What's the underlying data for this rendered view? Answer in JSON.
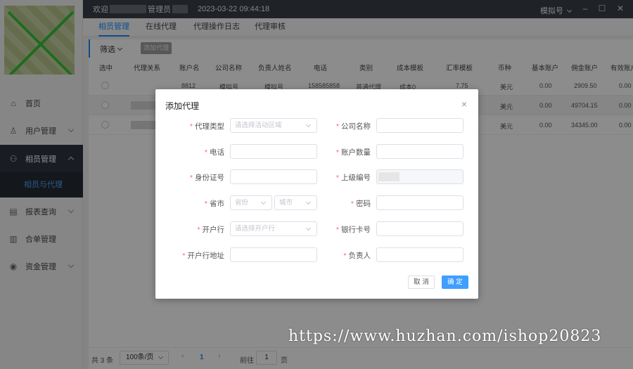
{
  "topbar": {
    "welcome_prefix": "欢迎",
    "welcome_suffix": "管理员",
    "datetime": "2023-03-22 09:44:18",
    "user": "模拟号"
  },
  "tabs": [
    "相员管理",
    "在线代理",
    "代理操作日志",
    "代理审核"
  ],
  "sidebar": {
    "items": [
      {
        "label": "首页",
        "icon": "home-icon"
      },
      {
        "label": "用户管理",
        "icon": "user-icon"
      },
      {
        "label": "相员管理",
        "icon": "users-icon"
      },
      {
        "label": "报表查询",
        "icon": "report-icon"
      },
      {
        "label": "合单管理",
        "icon": "order-icon"
      },
      {
        "label": "资金管理",
        "icon": "money-icon"
      }
    ],
    "sub_item": "相员与代理"
  },
  "toolbar": {
    "filter_label": "筛选",
    "add_button": "添加代理"
  },
  "table": {
    "columns": [
      "选中",
      "代理关系",
      "账户名",
      "公司名称",
      "负责人姓名",
      "电话",
      "类别",
      "成本模板",
      "汇率模板",
      "币种",
      "基本账户",
      "佣金账户",
      "有效账户"
    ],
    "rows": [
      {
        "account": "8812",
        "company": "模拟号",
        "contact": "模拟号",
        "phone": "158585858",
        "category": "普通代理",
        "cost_template": "成本0",
        "rate_template": "7.75",
        "currency": "美元",
        "basic": "0.00",
        "commission": "2909.50",
        "valid": "0.00"
      },
      {
        "account": "",
        "company": "",
        "contact": "",
        "phone": "",
        "category": "",
        "cost_template": "",
        "rate_template": "",
        "currency": "美元",
        "basic": "0.00",
        "commission": "49704.15",
        "valid": "0.00"
      },
      {
        "account": "",
        "company": "",
        "contact": "",
        "phone": "",
        "category": "",
        "cost_template": "",
        "rate_template": "",
        "currency": "美元",
        "basic": "0.00",
        "commission": "34345.00",
        "valid": "0.00"
      }
    ]
  },
  "pagination": {
    "total": "共 3 条",
    "page_size": "100条/页",
    "prev": "‹",
    "current": "1",
    "next": "›",
    "goto_label": "前往",
    "goto_value": "1",
    "page_suffix": "页"
  },
  "modal": {
    "title": "添加代理",
    "close": "×",
    "fields": {
      "agent_type": {
        "label": "代理类型",
        "placeholder": "请选择活动区域",
        "required": true
      },
      "company": {
        "label": "公司名称",
        "placeholder": "",
        "required": true
      },
      "phone": {
        "label": "电话",
        "placeholder": "",
        "required": true
      },
      "account_count": {
        "label": "账户数量",
        "placeholder": "",
        "required": true
      },
      "id_number": {
        "label": "身份证号",
        "placeholder": "",
        "required": true
      },
      "parent_code": {
        "label": "上级编号",
        "placeholder": "",
        "required": true
      },
      "province_city": {
        "label": "省市",
        "province_placeholder": "省份",
        "city_placeholder": "城市",
        "required": true
      },
      "password": {
        "label": "密码",
        "placeholder": "",
        "required": true
      },
      "bank": {
        "label": "开户行",
        "placeholder": "请选择开户行",
        "required": true
      },
      "bank_card": {
        "label": "银行卡号",
        "placeholder": "",
        "required": true
      },
      "bank_address": {
        "label": "开户行地址",
        "placeholder": "",
        "required": true
      },
      "person_in_charge": {
        "label": "负责人",
        "placeholder": "",
        "required": true
      }
    },
    "cancel_label": "取 消",
    "ok_label": "确 定"
  },
  "watermark": "https://www.huzhan.com/ishop20823",
  "colors": {
    "accent": "#409eff",
    "sidebar_active": "#2f3640",
    "topbar": "#3a3f47",
    "required": "#f56c6c"
  }
}
